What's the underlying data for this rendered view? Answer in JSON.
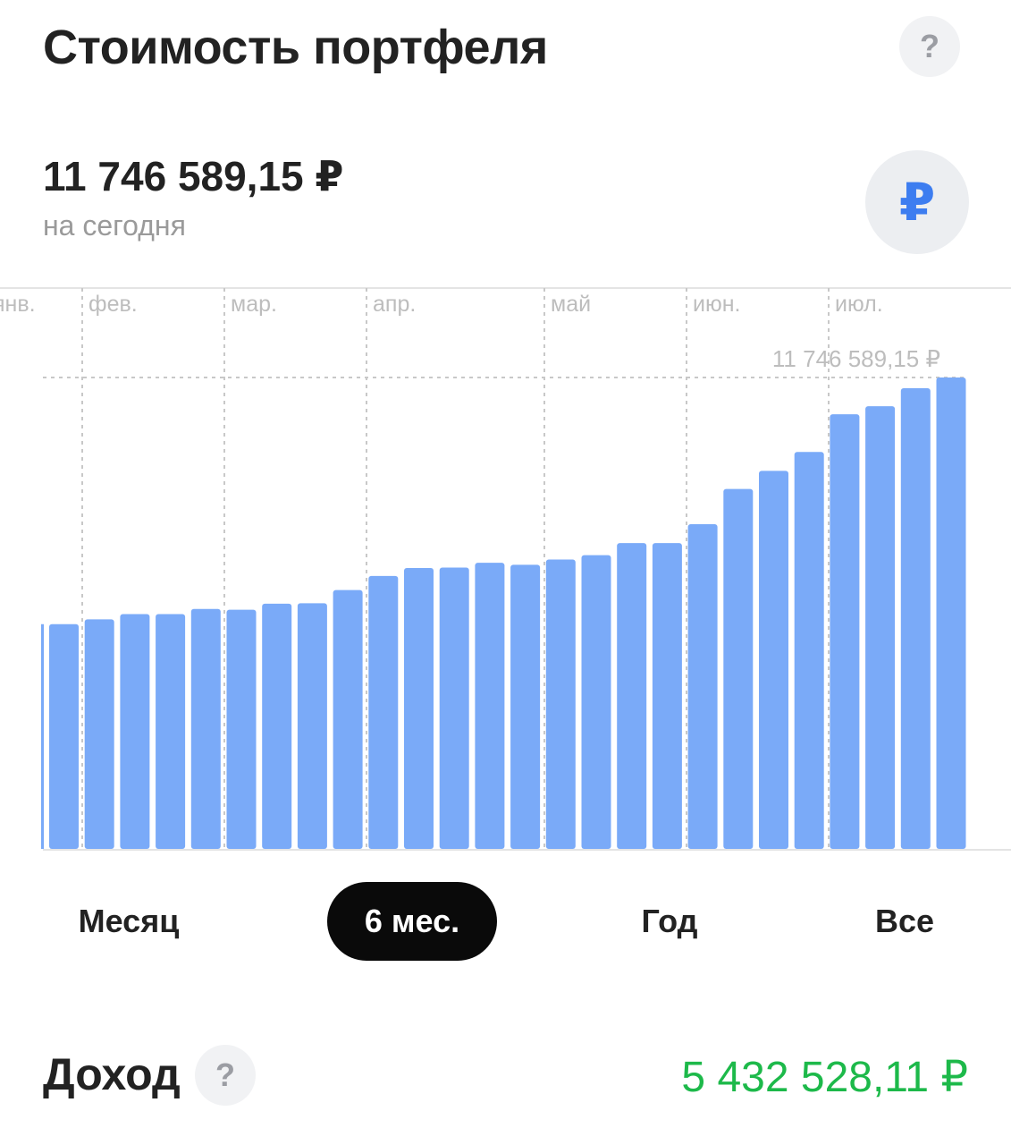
{
  "header": {
    "title": "Стоимость портфеля",
    "help_label": "?"
  },
  "portfolio": {
    "value": "11 746 589,15 ₽",
    "subtitle": "на сегодня",
    "currency_symbol": "₽"
  },
  "chart_data": {
    "type": "bar",
    "month_labels": [
      "янв.",
      "фев.",
      "мар.",
      "апр.",
      "май",
      "июн.",
      "июл."
    ],
    "max_label": "11 746 589,15 ₽",
    "values": [
      5600000,
      5600000,
      5720000,
      5850000,
      5850000,
      5980000,
      5960000,
      6110000,
      6120000,
      6450000,
      6800000,
      7000000,
      7010000,
      7130000,
      7080000,
      7210000,
      7320000,
      7620000,
      7620000,
      8090000,
      8970000,
      9420000,
      9890000,
      10830000,
      11030000,
      11480000,
      11746589.15
    ],
    "ylim": [
      0,
      11746589.15
    ],
    "bar_color": "#7aaaf8",
    "grid": true
  },
  "periods": {
    "tabs": [
      "Месяц",
      "6 мес.",
      "Год",
      "Все"
    ],
    "active": "6 мес."
  },
  "income": {
    "label": "Доход",
    "help_label": "?",
    "value": "5 432 528,11 ₽",
    "value_color": "#1db94a"
  }
}
